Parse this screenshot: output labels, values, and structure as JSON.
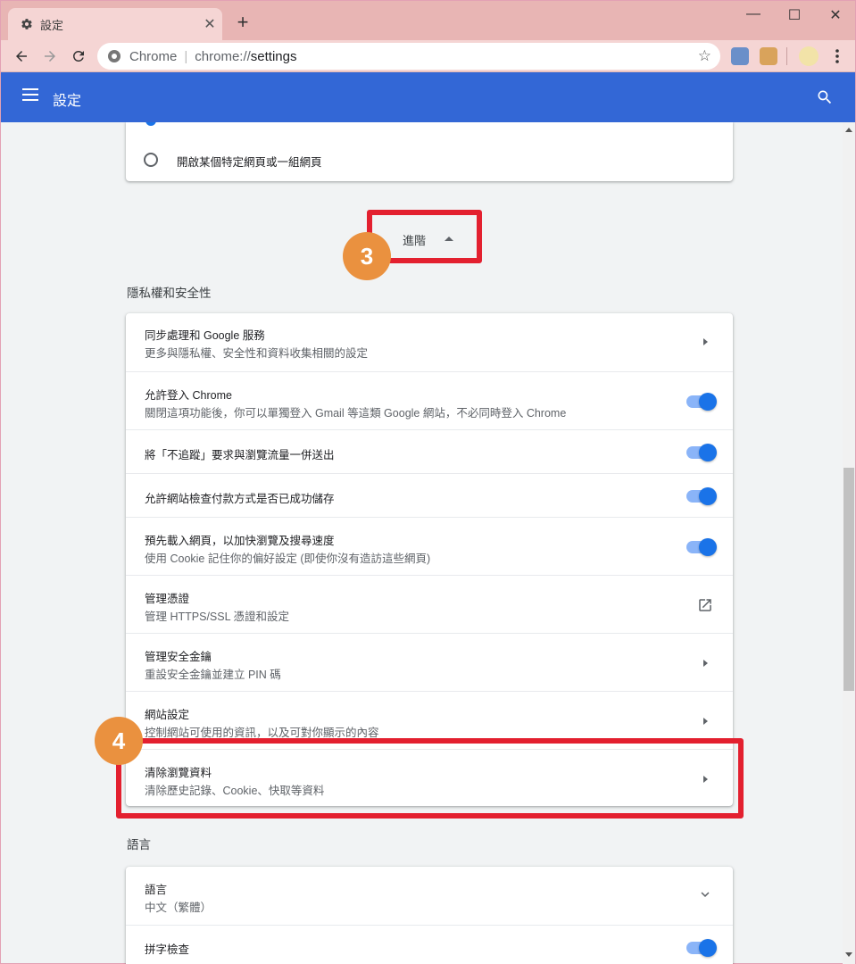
{
  "browser": {
    "tab_title": "設定",
    "tab_close": "✕",
    "new_tab": "+",
    "window_controls": {
      "minimize": "—",
      "maximize": "☐",
      "close": "✕"
    },
    "omnibox_chip": "Chrome",
    "omnibox_url_scheme": "chrome://",
    "omnibox_url_path": "settings",
    "star_icon": "☆"
  },
  "appbar": {
    "title": "設定"
  },
  "startup": {
    "radio_option": "開啟某個特定網頁或一組網頁"
  },
  "advanced": {
    "label": "進階",
    "callout_number": "3"
  },
  "privacy": {
    "section_title": "隱私權和安全性",
    "rows": [
      {
        "title": "同步處理和 Google 服務",
        "subtitle": "更多與隱私權、安全性和資料收集相關的設定",
        "control": "chevron"
      },
      {
        "title": "允許登入 Chrome",
        "subtitle": "關閉這項功能後，你可以單獨登入 Gmail 等這類 Google 網站，不必同時登入 Chrome",
        "control": "toggle-on"
      },
      {
        "title": "將「不追蹤」要求與瀏覽流量一併送出",
        "subtitle": "",
        "control": "toggle-on"
      },
      {
        "title": "允許網站檢查付款方式是否已成功儲存",
        "subtitle": "",
        "control": "toggle-on"
      },
      {
        "title": "預先載入網頁，以加快瀏覽及搜尋速度",
        "subtitle": "使用 Cookie 記住你的偏好設定 (即使你沒有造訪這些網頁)",
        "control": "toggle-on"
      },
      {
        "title": "管理憑證",
        "subtitle": "管理 HTTPS/SSL 憑證和設定",
        "control": "external-link"
      },
      {
        "title": "管理安全金鑰",
        "subtitle": "重設安全金鑰並建立 PIN 碼",
        "control": "chevron"
      },
      {
        "title": "網站設定",
        "subtitle": "控制網站可使用的資訊，以及可對你顯示的內容",
        "control": "chevron"
      },
      {
        "title": "清除瀏覽資料",
        "subtitle": "清除歷史記錄、Cookie、快取等資料",
        "control": "chevron"
      }
    ],
    "callout_number": "4"
  },
  "languages": {
    "section_title": "語言",
    "rows": [
      {
        "title": "語言",
        "subtitle": "中文（繁體）",
        "control": "expand"
      },
      {
        "title": "拼字檢查",
        "subtitle": "",
        "control": "toggle-on"
      }
    ]
  },
  "colors": {
    "accent": "#3367d6",
    "toggle": "#1a73e8",
    "callout": "#e3202f",
    "badge": "#ea913f",
    "titlebar": "#e8b5b4"
  }
}
